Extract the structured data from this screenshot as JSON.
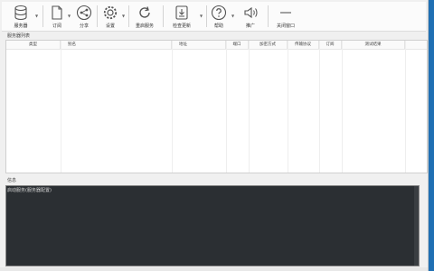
{
  "toolbar": {
    "buttons": [
      {
        "label": "服务器",
        "icon": "database-icon"
      },
      {
        "label": "订阅",
        "icon": "document-icon"
      },
      {
        "label": "分享",
        "icon": "share-icon"
      },
      {
        "label": "设置",
        "icon": "gear-icon"
      },
      {
        "label": "重启服务",
        "icon": "refresh-icon"
      },
      {
        "label": "检查更新",
        "icon": "download-icon"
      },
      {
        "label": "帮助",
        "icon": "help-icon"
      },
      {
        "label": "推广",
        "icon": "speaker-icon"
      },
      {
        "label": "关闭窗口",
        "icon": "close-window-icon"
      }
    ]
  },
  "server_list": {
    "title": "服务器列表",
    "columns": [
      "类型",
      "别名",
      "地址",
      "端口",
      "加密方式",
      "传输协议",
      "订阅",
      "测试结果"
    ]
  },
  "log": {
    "title": "信息",
    "lines": [
      "启动服务(服务器配置)"
    ]
  },
  "colors": {
    "desktop": "#1f6fb3",
    "window_bg": "#f0f0f0",
    "log_bg": "#2b2f33"
  }
}
